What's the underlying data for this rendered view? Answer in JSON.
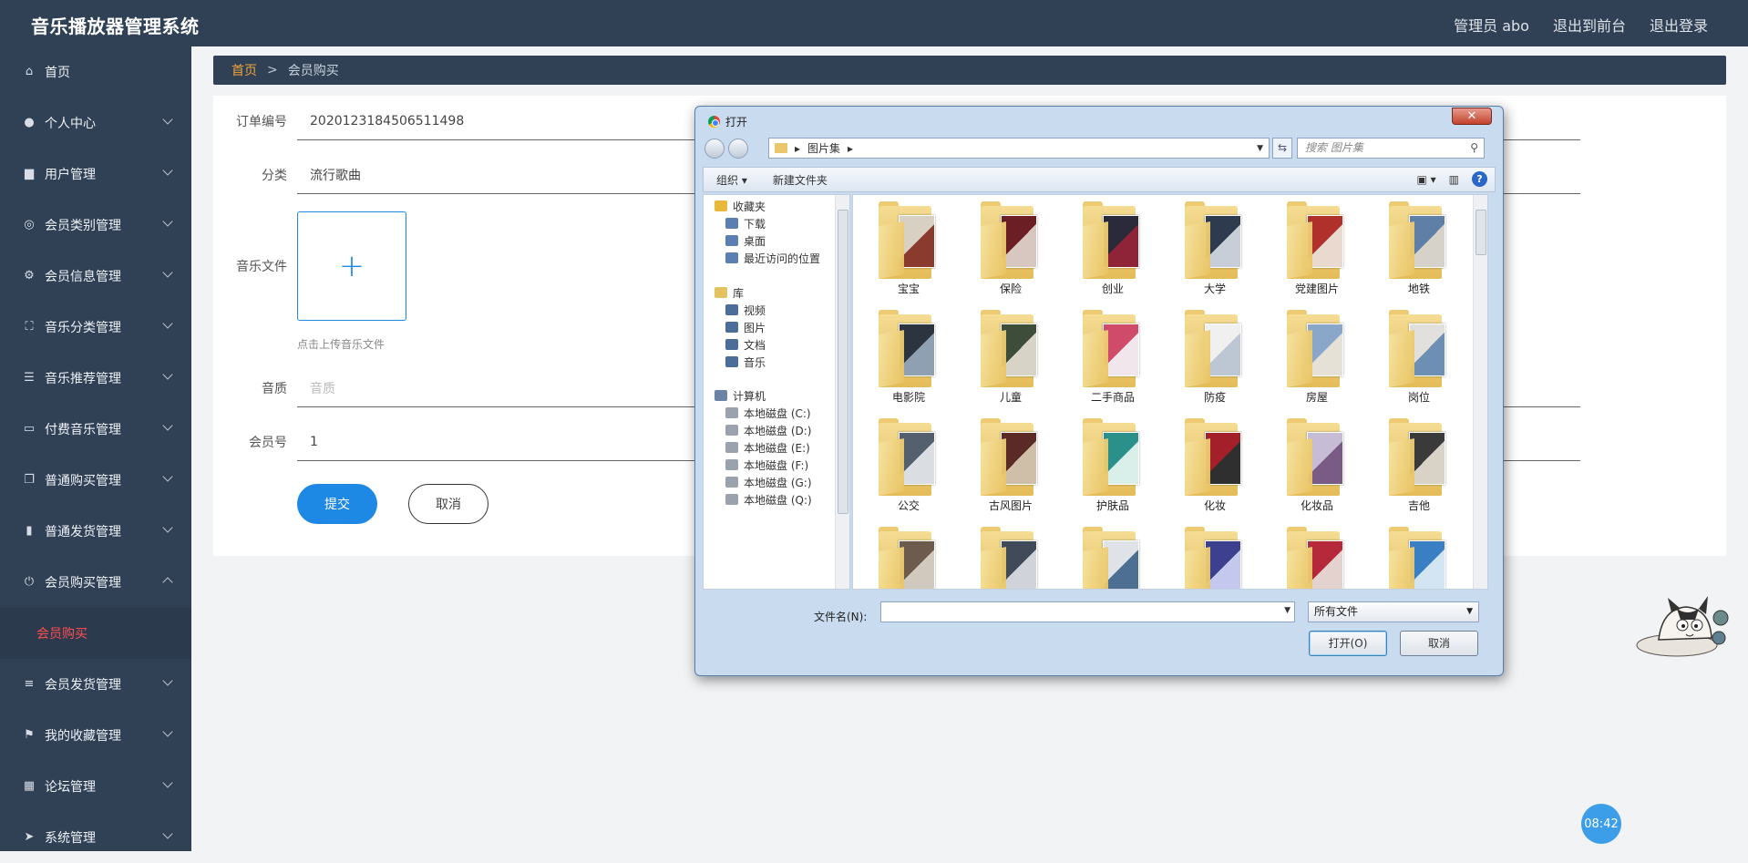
{
  "app": {
    "title": "音乐播放器管理系统"
  },
  "header": {
    "links": [
      "管理员 abo",
      "退出到前台",
      "退出登录"
    ]
  },
  "sidebar": {
    "items": [
      {
        "label": "首页",
        "icon": "home-icon",
        "glyph": "⌂",
        "expandable": false
      },
      {
        "label": "个人中心",
        "icon": "user-icon",
        "glyph": "●",
        "expandable": true
      },
      {
        "label": "用户管理",
        "icon": "monitor-icon",
        "glyph": "▆",
        "expandable": true
      },
      {
        "label": "会员类别管理",
        "icon": "compass-icon",
        "glyph": "◎",
        "expandable": true
      },
      {
        "label": "会员信息管理",
        "icon": "setting-icon",
        "glyph": "⚙",
        "expandable": true
      },
      {
        "label": "音乐分类管理",
        "icon": "fullscreen-icon",
        "glyph": "⛶",
        "expandable": true
      },
      {
        "label": "音乐推荐管理",
        "icon": "sliders-icon",
        "glyph": "☰",
        "expandable": true
      },
      {
        "label": "付费音乐管理",
        "icon": "card-icon",
        "glyph": "▭",
        "expandable": true
      },
      {
        "label": "普通购买管理",
        "icon": "copy-icon",
        "glyph": "❐",
        "expandable": true
      },
      {
        "label": "普通发货管理",
        "icon": "chart-icon",
        "glyph": "▮",
        "expandable": true
      },
      {
        "label": "会员购买管理",
        "icon": "power-icon",
        "glyph": "⏻",
        "expandable": true,
        "open": true
      },
      {
        "label": "会员发货管理",
        "icon": "list-icon",
        "glyph": "≡",
        "expandable": true
      },
      {
        "label": "我的收藏管理",
        "icon": "flag-icon",
        "glyph": "⚑",
        "expandable": true
      },
      {
        "label": "论坛管理",
        "icon": "grid-icon",
        "glyph": "▦",
        "expandable": true
      },
      {
        "label": "系统管理",
        "icon": "send-icon",
        "glyph": "➤",
        "expandable": true
      }
    ],
    "active_sub": "会员购买"
  },
  "breadcrumb": {
    "home": "首页",
    "sep": ">",
    "current": "会员购买"
  },
  "form": {
    "order_label": "订单编号",
    "order_value": "2020123184506511498",
    "category_label": "分类",
    "category_value": "流行歌曲",
    "file_label": "音乐文件",
    "upload_plus": "+",
    "upload_hint": "点击上传音乐文件",
    "quality_label": "音质",
    "quality_placeholder": "音质",
    "member_label": "会员号",
    "member_value": "1",
    "submit": "提交",
    "cancel": "取消"
  },
  "clock": "08:42",
  "dialog": {
    "title": "打开",
    "close": "✕",
    "address": "图片集",
    "search_placeholder": "搜索 图片集",
    "toolbar": {
      "organize": "组织 ▾",
      "new_folder": "新建文件夹"
    },
    "nav": {
      "favorites": "收藏夹",
      "fav_items": [
        "下载",
        "桌面",
        "最近访问的位置"
      ],
      "libraries": "库",
      "lib_items": [
        "视频",
        "图片",
        "文档",
        "音乐"
      ],
      "computer": "计算机",
      "drives": [
        "本地磁盘 (C:)",
        "本地磁盘 (D:)",
        "本地磁盘 (E:)",
        "本地磁盘 (F:)",
        "本地磁盘 (G:)",
        "本地磁盘 (Q:)"
      ]
    },
    "folders": [
      {
        "name": "宝宝",
        "c1": "#d9d0c4",
        "c2": "#8a3b2e"
      },
      {
        "name": "保险",
        "c1": "#6b1f24",
        "c2": "#d8c7c1"
      },
      {
        "name": "创业",
        "c1": "#2a2a3a",
        "c2": "#8f2337"
      },
      {
        "name": "大学",
        "c1": "#2e3b4f",
        "c2": "#c7ced8"
      },
      {
        "name": "党建图片",
        "c1": "#b0302c",
        "c2": "#e9d9cf"
      },
      {
        "name": "地铁",
        "c1": "#5f7fa6",
        "c2": "#d7d2c9"
      },
      {
        "name": "电影院",
        "c1": "#2c3440",
        "c2": "#8fa0b3"
      },
      {
        "name": "儿童",
        "c1": "#3e4c3a",
        "c2": "#d8d3c7"
      },
      {
        "name": "二手商品",
        "c1": "#d04a6a",
        "c2": "#f0e6ec"
      },
      {
        "name": "防疫",
        "c1": "#f0f0f0",
        "c2": "#bcc7d3"
      },
      {
        "name": "房屋",
        "c1": "#8aa7c9",
        "c2": "#e6e1d6"
      },
      {
        "name": "岗位",
        "c1": "#e2e0dc",
        "c2": "#6d8fb3"
      },
      {
        "name": "公交",
        "c1": "#54606d",
        "c2": "#dadde1"
      },
      {
        "name": "古风图片",
        "c1": "#5c2a26",
        "c2": "#cfbfa8"
      },
      {
        "name": "护肤品",
        "c1": "#2b8f8a",
        "c2": "#d9efe9"
      },
      {
        "name": "化妆",
        "c1": "#a31f2a",
        "c2": "#2f2f2f"
      },
      {
        "name": "化妆品",
        "c1": "#c7bcd5",
        "c2": "#7a5b86"
      },
      {
        "name": "吉他",
        "c1": "#3a3a3a",
        "c2": "#d9d2c6"
      },
      {
        "name": "",
        "c1": "#6d5b4d",
        "c2": "#d1c8be"
      },
      {
        "name": "",
        "c1": "#404a58",
        "c2": "#d0d4da"
      },
      {
        "name": "",
        "c1": "#dfe3e8",
        "c2": "#4d6f91"
      },
      {
        "name": "",
        "c1": "#3d3f8f",
        "c2": "#c4c8ee"
      },
      {
        "name": "",
        "c1": "#b6293a",
        "c2": "#e4d2cf"
      },
      {
        "name": "",
        "c1": "#3a7ec4",
        "c2": "#d3e4f2"
      }
    ],
    "filename_label": "文件名(N):",
    "filetype": "所有文件",
    "open_btn": "打开(O)",
    "cancel_btn": "取消"
  }
}
